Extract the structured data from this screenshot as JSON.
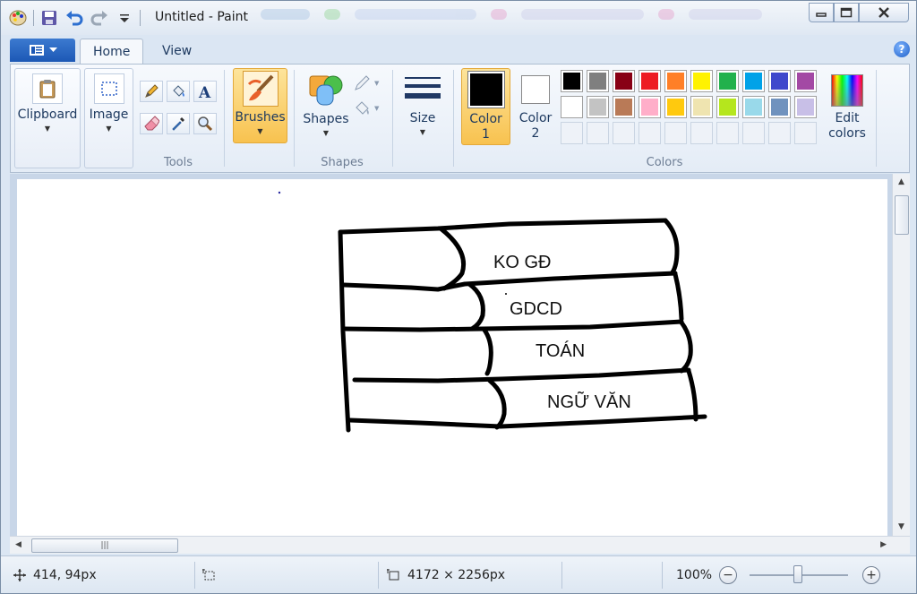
{
  "window": {
    "title": "Untitled - Paint",
    "controls": {
      "minimize": "minimize-icon",
      "maximize": "maximize-icon",
      "close": "close-icon"
    }
  },
  "quick_access": [
    "paint-app-icon",
    "save-icon",
    "undo-icon",
    "redo-icon",
    "customize-dropdown-icon"
  ],
  "ribbon": {
    "tabs": [
      {
        "label": "Home",
        "active": true
      },
      {
        "label": "View",
        "active": false
      }
    ],
    "groups": {
      "clipboard": {
        "label": "Clipboard"
      },
      "image": {
        "label": "Image"
      },
      "tools": {
        "label": "Tools"
      },
      "brushes": {
        "label": "Brushes",
        "selected": true
      },
      "shapes": {
        "label": "Shapes",
        "button_label": "Shapes"
      },
      "size": {
        "label": "Size"
      },
      "colors": {
        "label": "Colors",
        "color1_label_line1": "Color",
        "color1_label_line2": "1",
        "color2_label_line1": "Color",
        "color2_label_line2": "2",
        "color1": "#000000",
        "color2": "#ffffff",
        "edit_label_line1": "Edit",
        "edit_label_line2": "colors",
        "palette_row1": [
          "#000000",
          "#7f7f7f",
          "#880015",
          "#ed1c24",
          "#ff7f27",
          "#fff200",
          "#22b14c",
          "#00a2e8",
          "#3f48cc",
          "#a349a4"
        ],
        "palette_row2": [
          "#ffffff",
          "#c3c3c3",
          "#b97a57",
          "#ffaec9",
          "#ffc90e",
          "#efe4b0",
          "#b5e61d",
          "#99d9ea",
          "#7092be",
          "#c8bfe7"
        ],
        "custom_slots": 10
      }
    }
  },
  "canvas": {
    "drawing_labels": [
      "KO GĐ",
      "GDCD",
      "TOÁN",
      "NGỮ VĂN"
    ]
  },
  "status": {
    "cursor_position": "414, 94px",
    "selection_size": "",
    "image_size": "4172 × 2256px",
    "zoom": "100%"
  }
}
